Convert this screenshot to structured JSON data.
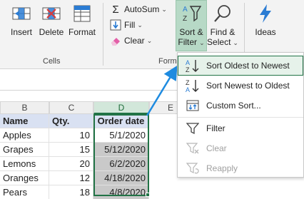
{
  "ribbon": {
    "insert_label": "Insert",
    "delete_label": "Delete",
    "format_label": "Format",
    "cells_group_label": "Cells",
    "autosum_label": "AutoSum",
    "fill_label": "Fill",
    "clear_label": "Clear",
    "editing_group_label_partial": "Form",
    "sort_filter_label_1": "Sort &",
    "sort_filter_label_2": "Filter",
    "find_select_label_1": "Find &",
    "find_select_label_2": "Select",
    "ideas_label": "Ideas",
    "caret": "⌄"
  },
  "sheet": {
    "column_headers": [
      "B",
      "C",
      "D",
      "E"
    ],
    "header_row": {
      "name": "Name",
      "qty": "Qty.",
      "date": "Order date"
    },
    "rows": [
      {
        "name": "Apples",
        "qty": "10",
        "date": "5/1/2020"
      },
      {
        "name": "Grapes",
        "qty": "15",
        "date": "5/12/2020"
      },
      {
        "name": "Lemons",
        "qty": "20",
        "date": "6/2/2020"
      },
      {
        "name": "Oranges",
        "qty": "12",
        "date": "4/18/2020"
      },
      {
        "name": "Pears",
        "qty": "18",
        "date": "4/8/2020"
      }
    ]
  },
  "menu": {
    "sort_oldest": "Sort Oldest to Newest",
    "sort_newest": "Sort Newest to Oldest",
    "custom_sort": "Custom Sort...",
    "filter": "Filter",
    "clear": "Clear",
    "reapply": "Reapply"
  },
  "colors": {
    "excel_green": "#217346",
    "arrow_blue": "#1e8be0",
    "header_fill": "#d9e1f2",
    "selection_fill": "#c9c9c9"
  }
}
